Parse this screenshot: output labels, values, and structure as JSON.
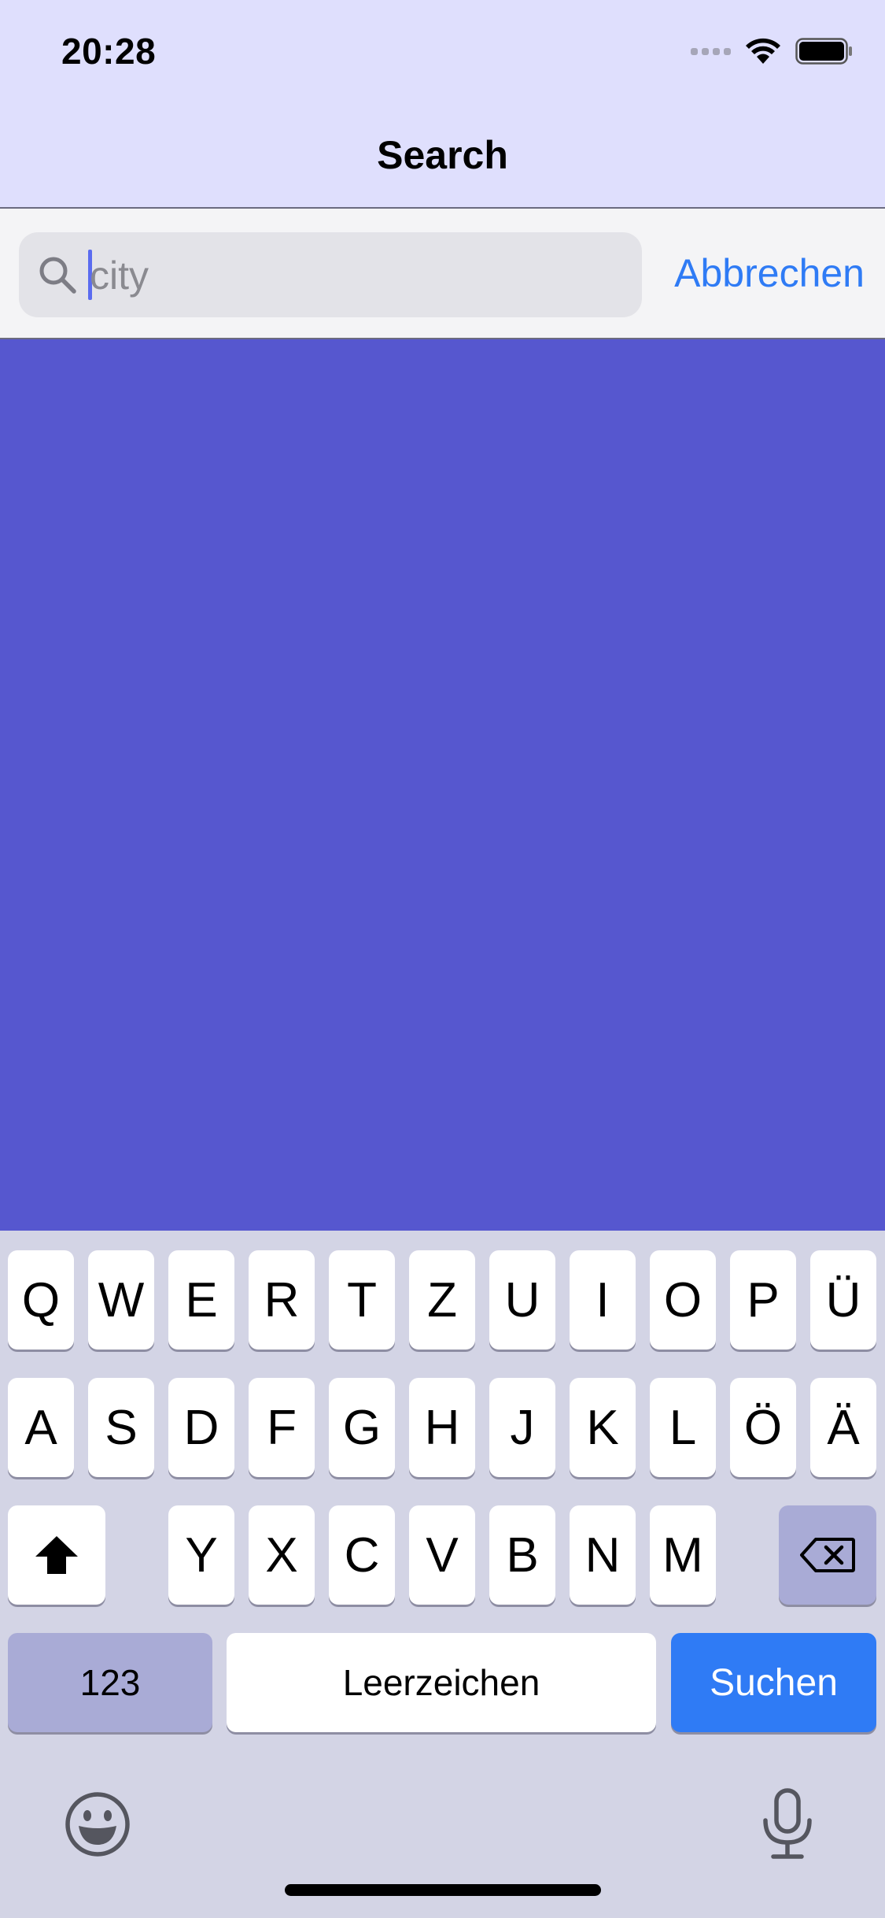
{
  "status_bar": {
    "time": "20:28"
  },
  "nav": {
    "title": "Search"
  },
  "search": {
    "placeholder": "city",
    "cancel_label": "Abbrechen"
  },
  "keyboard": {
    "row1": [
      "Q",
      "W",
      "E",
      "R",
      "T",
      "Z",
      "U",
      "I",
      "O",
      "P",
      "Ü"
    ],
    "row2": [
      "A",
      "S",
      "D",
      "F",
      "G",
      "H",
      "J",
      "K",
      "L",
      "Ö",
      "Ä"
    ],
    "row3": [
      "Y",
      "X",
      "C",
      "V",
      "B",
      "N",
      "M"
    ],
    "numbers_label": "123",
    "space_label": "Leerzeichen",
    "action_label": "Suchen"
  },
  "colors": {
    "header_bg": "#dfdffd",
    "content_bg": "#5657cf",
    "accent": "#2f7bf5",
    "keyboard_bg": "#d3d4e5"
  }
}
